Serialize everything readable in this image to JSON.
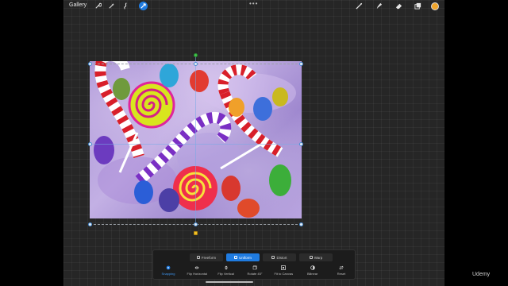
{
  "topbar": {
    "gallery_label": "Gallery",
    "tools_left": [
      "wrench-icon",
      "magic-wand-icon",
      "selection-icon",
      "transform-arrow-icon"
    ],
    "tools_right": [
      "brush-icon",
      "smudge-icon",
      "eraser-icon",
      "layers-icon",
      "color-swatch-icon"
    ],
    "active_color": "#f0a52c",
    "accent_color": "#1f7be0"
  },
  "transform": {
    "modes": [
      {
        "label": "Freeform",
        "active": false
      },
      {
        "label": "Uniform",
        "active": true
      },
      {
        "label": "Distort",
        "active": false
      },
      {
        "label": "Warp",
        "active": false
      }
    ],
    "actions": [
      {
        "label": "Snapping",
        "icon": "snapping-icon",
        "active": true
      },
      {
        "label": "Flip Horizontal",
        "icon": "flip-horizontal-icon",
        "active": false
      },
      {
        "label": "Flip Vertical",
        "icon": "flip-vertical-icon",
        "active": false
      },
      {
        "label": "Rotate 45°",
        "icon": "rotate-icon",
        "active": false
      },
      {
        "label": "Fit to Canvas",
        "icon": "fit-to-canvas-icon",
        "active": false
      },
      {
        "label": "Bilinear",
        "icon": "bilinear-icon",
        "active": false
      },
      {
        "label": "Reset",
        "icon": "reset-icon",
        "active": false
      }
    ]
  },
  "watermark": "Udemy"
}
